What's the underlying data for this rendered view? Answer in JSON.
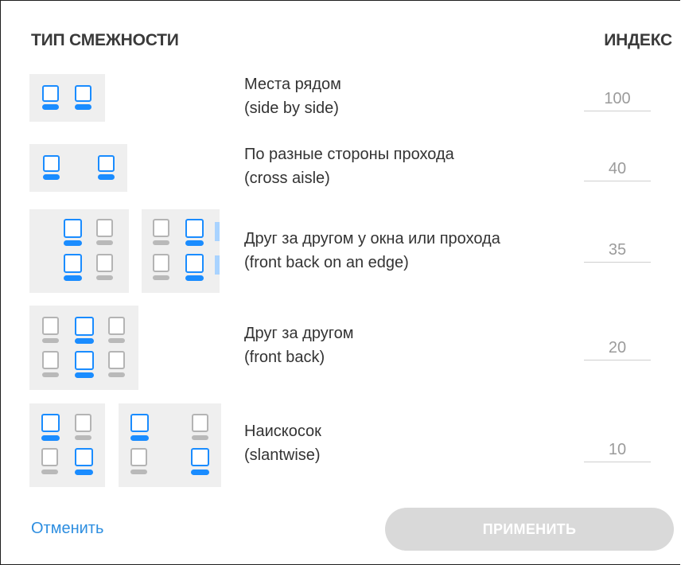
{
  "header": {
    "type_label": "ТИП СМЕЖНОСТИ",
    "index_label": "ИНДЕКС"
  },
  "rows": [
    {
      "title": "Места рядом",
      "subtitle": "(side by side)",
      "index": "100"
    },
    {
      "title": "По разные стороны прохода",
      "subtitle": "(cross aisle)",
      "index": "40"
    },
    {
      "title": "Друг за другом у окна или прохода",
      "subtitle": "(front back on an edge)",
      "index": "35"
    },
    {
      "title": "Друг за другом",
      "subtitle": "(front back)",
      "index": "20"
    },
    {
      "title": "Наискосок",
      "subtitle": "(slantwise)",
      "index": "10"
    }
  ],
  "footer": {
    "cancel_label": "Отменить",
    "apply_label": "ПРИМЕНИТЬ"
  },
  "colors": {
    "selected_seat": "#1a8cff",
    "unselected_seat": "#b4b4b4",
    "edge_marker": "#a9d3ff",
    "panel_bg": "#efefef",
    "link": "#2d8ee0",
    "button_disabled": "#d9d9d9"
  }
}
